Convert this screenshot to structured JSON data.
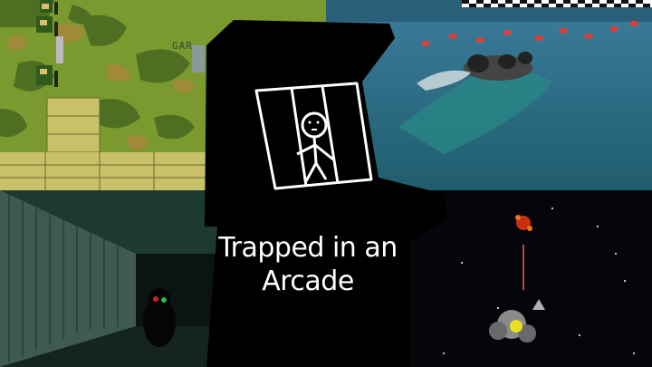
{
  "title": {
    "line1": "Trapped in an",
    "line2": "Arcade"
  },
  "sign_text": "GAR",
  "colors": {
    "cabinet": "#000000",
    "outline": "#ffffff",
    "camo_green": "#6b8a2a",
    "water": "#2f6b86",
    "corridor": "#1f3a33",
    "space": "#04060b"
  }
}
